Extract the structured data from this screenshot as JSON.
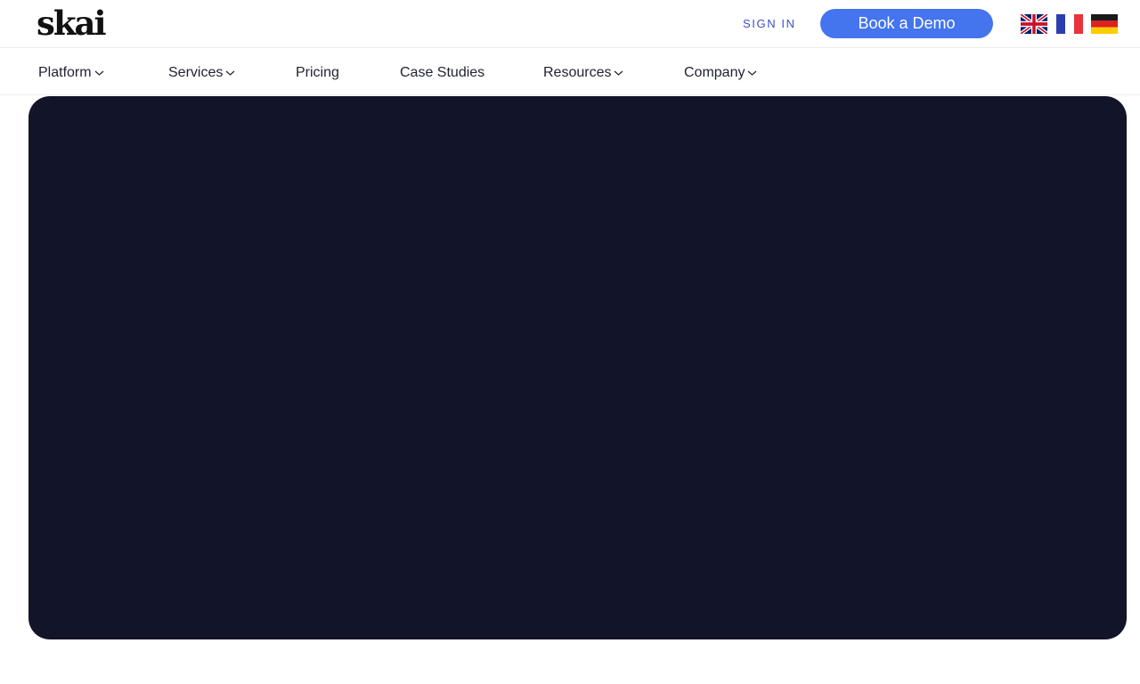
{
  "header": {
    "logo_text": "skai",
    "sign_in_label": "SIGN IN",
    "book_demo_label": "Book a Demo",
    "colors": {
      "accent": "#4474ee",
      "sign_in": "#3c4ecf",
      "hero_background": "#12142a"
    },
    "languages": [
      {
        "icon": "uk-flag-icon"
      },
      {
        "icon": "france-flag-icon"
      },
      {
        "icon": "germany-flag-icon"
      }
    ]
  },
  "nav": {
    "items": [
      {
        "label": "Platform",
        "has_dropdown": true
      },
      {
        "label": "Services",
        "has_dropdown": true
      },
      {
        "label": "Pricing",
        "has_dropdown": false
      },
      {
        "label": "Case Studies",
        "has_dropdown": false
      },
      {
        "label": "Resources",
        "has_dropdown": true
      },
      {
        "label": "Company",
        "has_dropdown": true
      }
    ]
  }
}
